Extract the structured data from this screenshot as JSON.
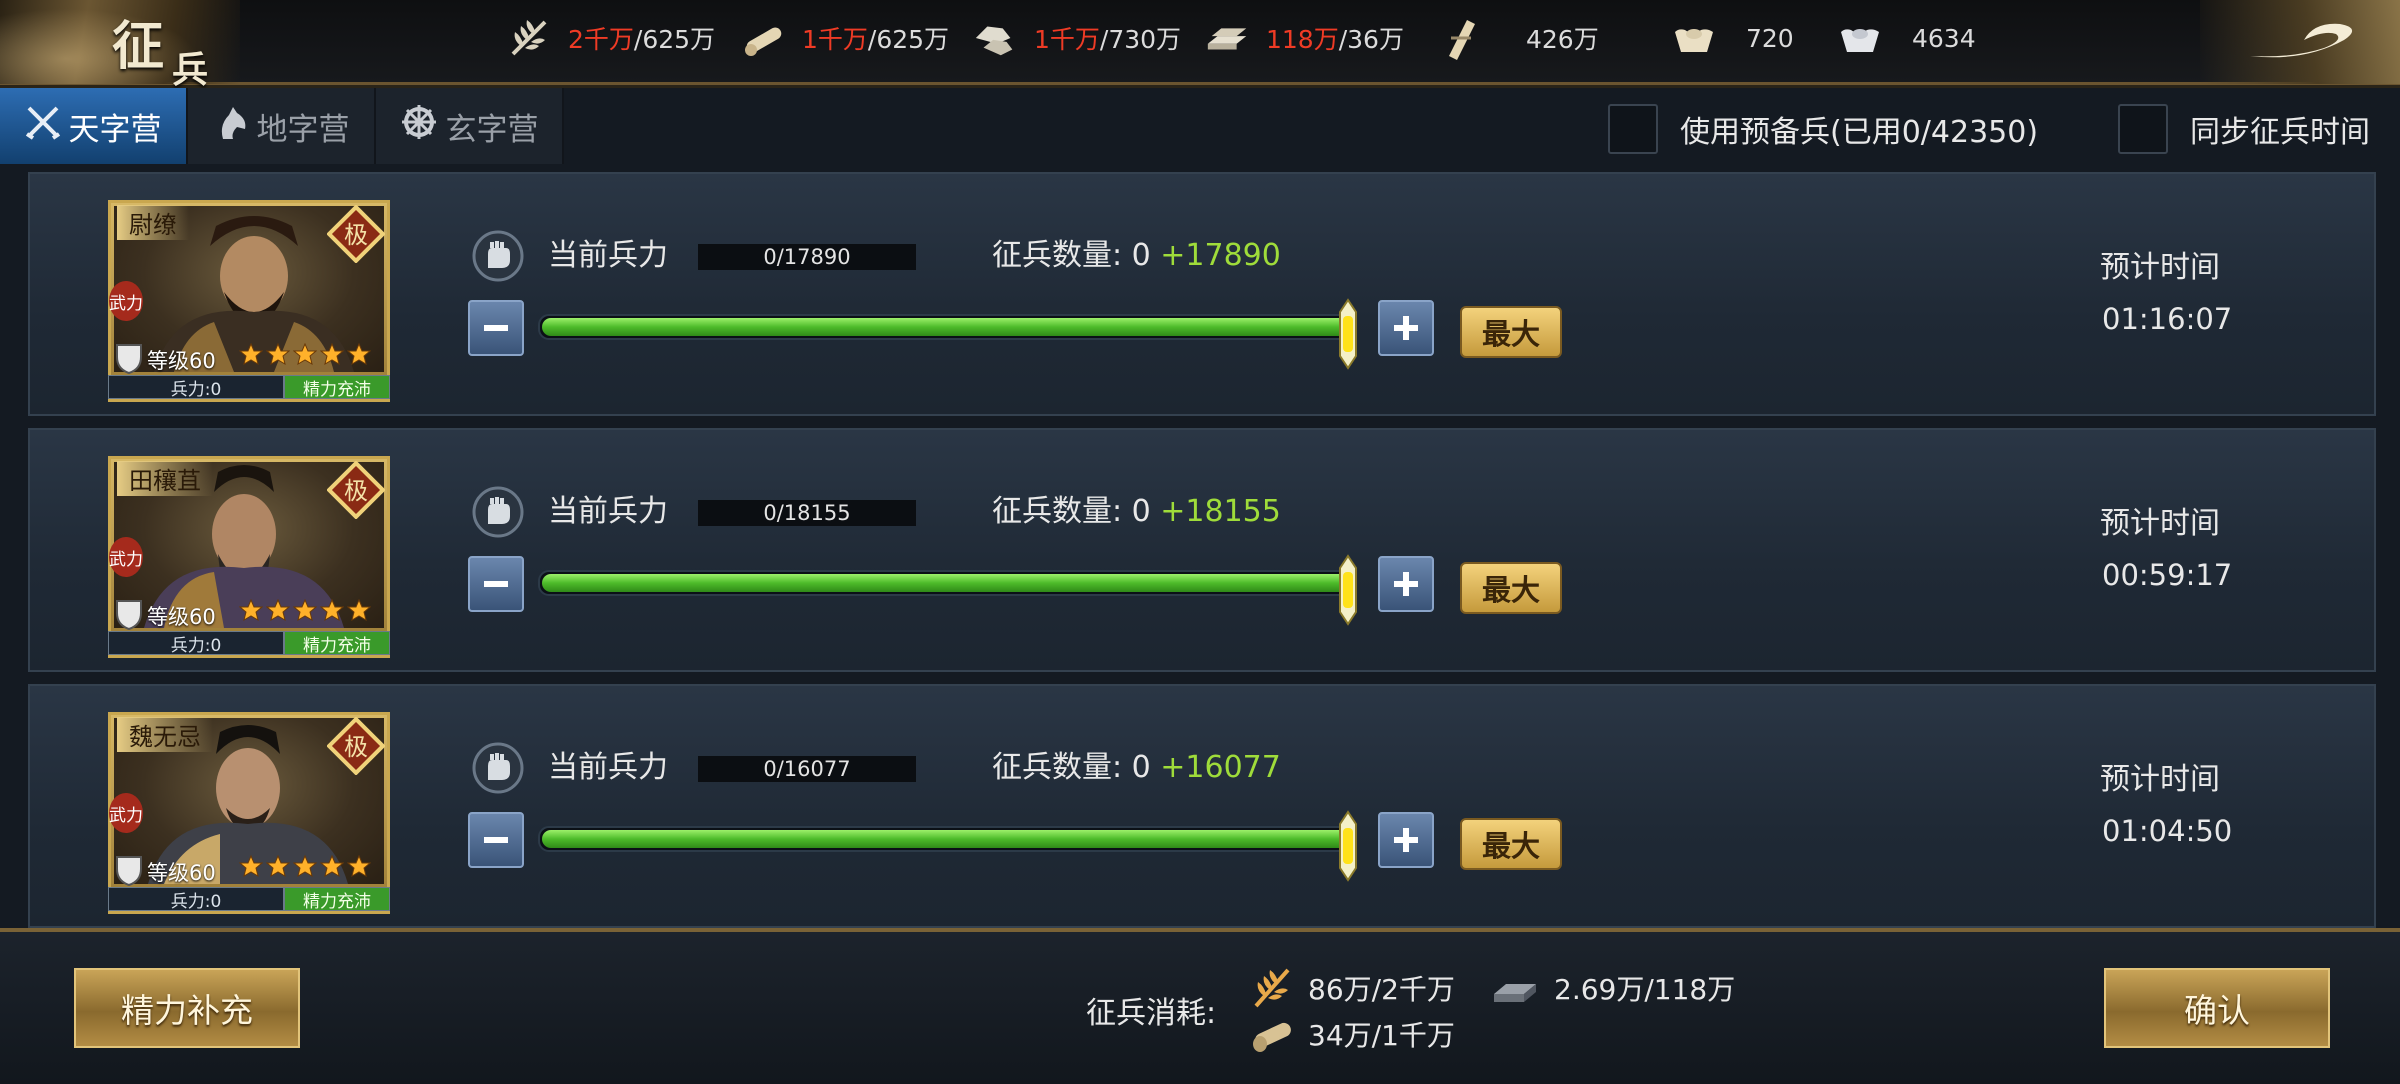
{
  "header": {
    "title_main": "征",
    "title_sub": "兵"
  },
  "resources": [
    {
      "icon": "grain-icon",
      "current": "2千万",
      "max": "/625万",
      "current_color": "#ef3b25"
    },
    {
      "icon": "wood-icon",
      "current": "1千万",
      "max": "/625万",
      "current_color": "#ef3b25"
    },
    {
      "icon": "stone-icon",
      "current": "1千万",
      "max": "/730万",
      "current_color": "#ef3b25"
    },
    {
      "icon": "iron-icon",
      "current": "118万",
      "max": "/36万",
      "current_color": "#ef3b25"
    },
    {
      "icon": "scroll-icon",
      "current": "",
      "max": "426万"
    },
    {
      "icon": "gold-ingot-icon",
      "current": "",
      "max": "720"
    },
    {
      "icon": "silver-ingot-icon",
      "current": "",
      "max": "4634"
    }
  ],
  "tabs": [
    {
      "label": "天字营",
      "icon": "crossed-swords-icon",
      "active": true
    },
    {
      "label": "地字营",
      "icon": "horse-head-icon",
      "active": false
    },
    {
      "label": "玄字营",
      "icon": "wheel-icon",
      "active": false
    }
  ],
  "options": {
    "reserve_label": "使用预备兵(已用0/42350)",
    "sync_label": "同步征兵时间"
  },
  "rows": [
    {
      "general": {
        "name": "尉缭",
        "tag": "武力",
        "level": "等级60",
        "stars": 5,
        "badge": "极",
        "troops": "兵力:0",
        "energy": "精力充沛"
      },
      "current_label": "当前兵力",
      "current_value": "0/17890",
      "recruit_label": "征兵数量: 0",
      "recruit_plus": "+17890",
      "slider_fraction": 1.0,
      "max_label": "最大",
      "est_label": "预计时间",
      "est_time": "01:16:07"
    },
    {
      "general": {
        "name": "田穰苴",
        "tag": "武力",
        "level": "等级60",
        "stars": 5,
        "badge": "极",
        "troops": "兵力:0",
        "energy": "精力充沛"
      },
      "current_label": "当前兵力",
      "current_value": "0/18155",
      "recruit_label": "征兵数量: 0",
      "recruit_plus": "+18155",
      "slider_fraction": 1.0,
      "max_label": "最大",
      "est_label": "预计时间",
      "est_time": "00:59:17"
    },
    {
      "general": {
        "name": "魏无忌",
        "tag": "武力",
        "level": "等级60",
        "stars": 5,
        "badge": "极",
        "troops": "兵力:0",
        "energy": "精力充沛"
      },
      "current_label": "当前兵力",
      "current_value": "0/16077",
      "recruit_label": "征兵数量: 0",
      "recruit_plus": "+16077",
      "slider_fraction": 1.0,
      "max_label": "最大",
      "est_label": "预计时间",
      "est_time": "01:04:50"
    }
  ],
  "footer": {
    "refill_label": "精力补充",
    "cost_label": "征兵消耗:",
    "costs": [
      {
        "icon": "grain-icon",
        "value": "86万/2千万"
      },
      {
        "icon": "wood-icon",
        "value": "34万/1千万"
      },
      {
        "icon": "iron-icon",
        "value": "2.69万/118万"
      }
    ],
    "confirm_label": "确认"
  }
}
